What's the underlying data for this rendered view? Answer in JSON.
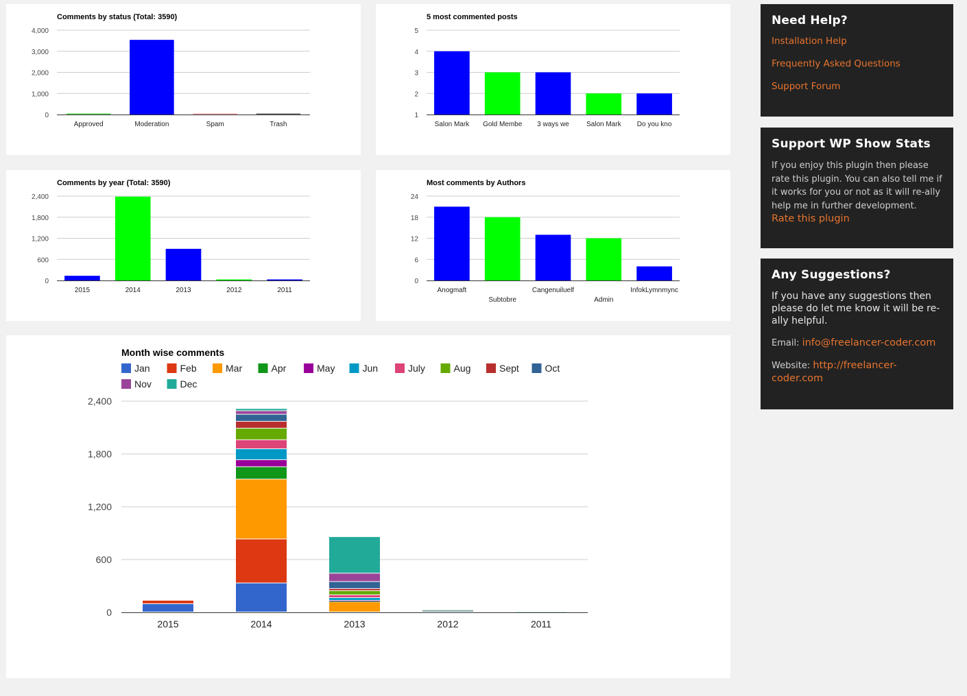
{
  "chart_data": [
    {
      "id": "status",
      "type": "bar",
      "title": "Comments by status (Total: 3590)",
      "categories": [
        "Approved",
        "Moderation",
        "Spam",
        "Trash"
      ],
      "values": [
        25,
        3540,
        15,
        10
      ],
      "colors": [
        "#4fd24f",
        "#0000ff",
        "#e8a0a0",
        "#666666"
      ],
      "yticks": [
        "0",
        "1,000",
        "2,000",
        "3,000",
        "4,000"
      ],
      "ylim": [
        0,
        4000
      ],
      "xlabel": "",
      "ylabel": "",
      "grid": true,
      "legend": "none"
    },
    {
      "id": "posts",
      "type": "bar",
      "title": "5 most commented posts",
      "categories": [
        "Salon Mark",
        "Gold Membe",
        "3 ways we",
        "Salon Mark",
        "Do you kno"
      ],
      "values": [
        4,
        3,
        3,
        2,
        2
      ],
      "colors": [
        "#0000ff",
        "#00ff00",
        "#0000ff",
        "#00ff00",
        "#0000ff"
      ],
      "yticks": [
        "1",
        "2",
        "3",
        "4",
        "5"
      ],
      "ylim": [
        1,
        5
      ],
      "xlabel": "",
      "ylabel": "",
      "grid": true,
      "legend": "none"
    },
    {
      "id": "year",
      "type": "bar",
      "title": "Comments by year (Total: 3590)",
      "categories": [
        "2015",
        "2014",
        "2013",
        "2012",
        "2011"
      ],
      "values": [
        133,
        2385,
        900,
        25,
        5
      ],
      "colors": [
        "#0000ff",
        "#00ff00",
        "#0000ff",
        "#00ff00",
        "#0000ff"
      ],
      "yticks": [
        "0",
        "600",
        "1,200",
        "1,800",
        "2,400"
      ],
      "ylim": [
        0,
        2400
      ],
      "xlabel": "",
      "ylabel": "",
      "grid": true,
      "legend": "none"
    },
    {
      "id": "authors",
      "type": "bar",
      "title": "Most comments by Authors",
      "categories": [
        "Anogmaft",
        "Subtobre",
        "Cangenuiluelf",
        "Admin",
        "InfokLymnmync"
      ],
      "values": [
        21,
        18,
        13,
        12,
        4
      ],
      "colors": [
        "#0000ff",
        "#00ff00",
        "#0000ff",
        "#00ff00",
        "#0000ff"
      ],
      "yticks": [
        "0",
        "6",
        "12",
        "18",
        "24"
      ],
      "ylim": [
        0,
        24
      ],
      "xlabel": "",
      "ylabel": "",
      "grid": true,
      "legend": "none"
    },
    {
      "id": "month",
      "type": "bar",
      "stacked": true,
      "title": "Month wise comments",
      "categories": [
        "2015",
        "2014",
        "2013",
        "2012",
        "2011"
      ],
      "yticks": [
        "0",
        "600",
        "1,200",
        "1,800",
        "2,400"
      ],
      "ylim": [
        0,
        2400
      ],
      "xlabel": "",
      "ylabel": "",
      "grid": true,
      "legend": "top",
      "series": [
        {
          "name": "Jan",
          "color": "#3366cc",
          "values": [
            94,
            330,
            0,
            0,
            0
          ]
        },
        {
          "name": "Feb",
          "color": "#dc3912",
          "values": [
            39,
            500,
            0,
            0,
            0
          ]
        },
        {
          "name": "Mar",
          "color": "#ff9900",
          "values": [
            0,
            680,
            115,
            0,
            0
          ]
        },
        {
          "name": "Apr",
          "color": "#109618",
          "values": [
            0,
            140,
            8,
            0,
            0
          ]
        },
        {
          "name": "May",
          "color": "#990099",
          "values": [
            0,
            80,
            8,
            0,
            0
          ]
        },
        {
          "name": "Jun",
          "color": "#0099c6",
          "values": [
            0,
            125,
            32,
            0,
            0
          ]
        },
        {
          "name": "July",
          "color": "#dd4477",
          "values": [
            0,
            102,
            32,
            0,
            0
          ]
        },
        {
          "name": "Aug",
          "color": "#66aa00",
          "values": [
            0,
            132,
            47,
            0,
            0
          ]
        },
        {
          "name": "Sept",
          "color": "#b82e2e",
          "values": [
            0,
            78,
            24,
            0,
            0
          ]
        },
        {
          "name": "Oct",
          "color": "#316395",
          "values": [
            0,
            80,
            80,
            0,
            0
          ]
        },
        {
          "name": "Nov",
          "color": "#994499",
          "values": [
            0,
            40,
            95,
            0,
            0
          ]
        },
        {
          "name": "Dec",
          "color": "#22aa99",
          "values": [
            0,
            25,
            415,
            25,
            2
          ]
        }
      ]
    }
  ],
  "sidebar": {
    "help": {
      "title": "Need Help?",
      "links": [
        "Installation Help",
        "Frequently Asked Questions",
        "Support Forum"
      ]
    },
    "support": {
      "title": "Support WP Show Stats",
      "text": "If you enjoy this plugin then please rate this plugin. You can also tell me if it works for you or not as it will re-ally help me in further development.",
      "link": "Rate this plugin"
    },
    "suggestions": {
      "title": "Any Suggestions?",
      "text": "If you have any suggestions then please do let me know it will be re-ally helpful.",
      "email_label": "Email:",
      "email": "info@freelancer-coder.com",
      "website_label": "Website:",
      "website": "http://freelancer-coder.com"
    }
  },
  "colors": {
    "page_bg": "#f1f1f1",
    "sidebar_bg": "#222222",
    "link": "#e8742e"
  }
}
